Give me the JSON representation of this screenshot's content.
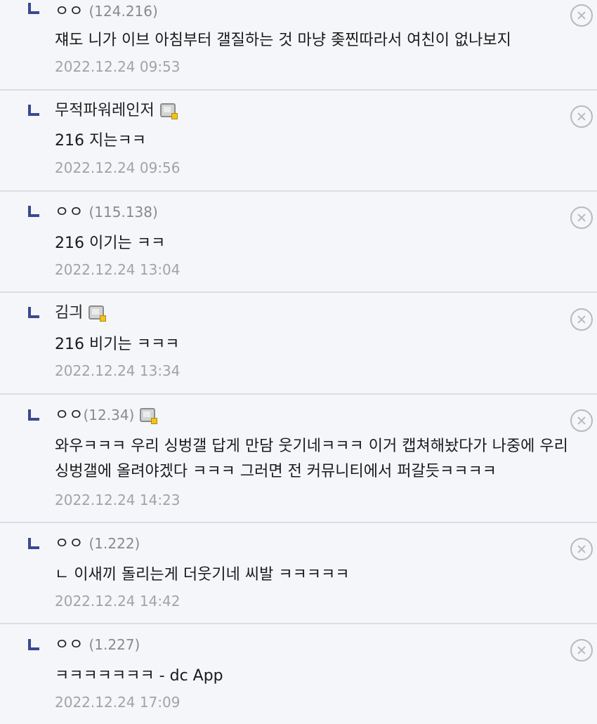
{
  "comments": [
    {
      "author": "ㅇㅇ",
      "ip": "(124.216)",
      "has_gallog_icon": false,
      "text": "쟤도 니가 이브 아침부터 갤질하는 것 마냥 좆찐따라서 여친이 없나보지",
      "date": "2022.12.24 09:53"
    },
    {
      "author": "무적파워레인저",
      "ip": "",
      "has_gallog_icon": true,
      "text": "216 지는ㅋㅋ",
      "date": "2022.12.24 09:56"
    },
    {
      "author": "ㅇㅇ",
      "ip": "(115.138)",
      "has_gallog_icon": false,
      "text": "216 이기는 ㅋㅋ",
      "date": "2022.12.24 13:04"
    },
    {
      "author": "김긔",
      "ip": "",
      "has_gallog_icon": true,
      "text": "216 비기는 ㅋㅋㅋ",
      "date": "2022.12.24 13:34"
    },
    {
      "author": "ㅇㅇ",
      "ip": "(12.34)",
      "has_gallog_icon": true,
      "text": "와우ㅋㅋㅋ 우리 싱벙갤 답게 만담 웃기네ㅋㅋㅋ 이거 캡쳐해놨다가 나중에 우리 싱벙갤에 올려야겠다 ㅋㅋㅋ 그러면 전 커뮤니티에서 퍼갈듯ㅋㅋㅋㅋ",
      "date": "2022.12.24 14:23"
    },
    {
      "author": "ㅇㅇ",
      "ip": "(1.222)",
      "has_gallog_icon": false,
      "text": "ㄴ 이새끼 돌리는게 더웃기네 씨발 ㅋㅋㅋㅋㅋ",
      "date": "2022.12.24 14:42"
    },
    {
      "author": "ㅇㅇ",
      "ip": "(1.227)",
      "has_gallog_icon": false,
      "text": "ㅋㅋㅋㅋㅋㅋㅋ - dc App",
      "date": "2022.12.24 17:09"
    }
  ],
  "colors": {
    "background": "#f5f6fa",
    "reply_mark": "#3b4890",
    "divider": "#dcdde3",
    "date_text": "#a3a3a3",
    "delete_icon": "#b9b9b9"
  },
  "icons": {
    "reply_mark": "reply-arrow-icon",
    "gallog": "gallog-icon",
    "delete": "delete-circle-x-icon"
  }
}
